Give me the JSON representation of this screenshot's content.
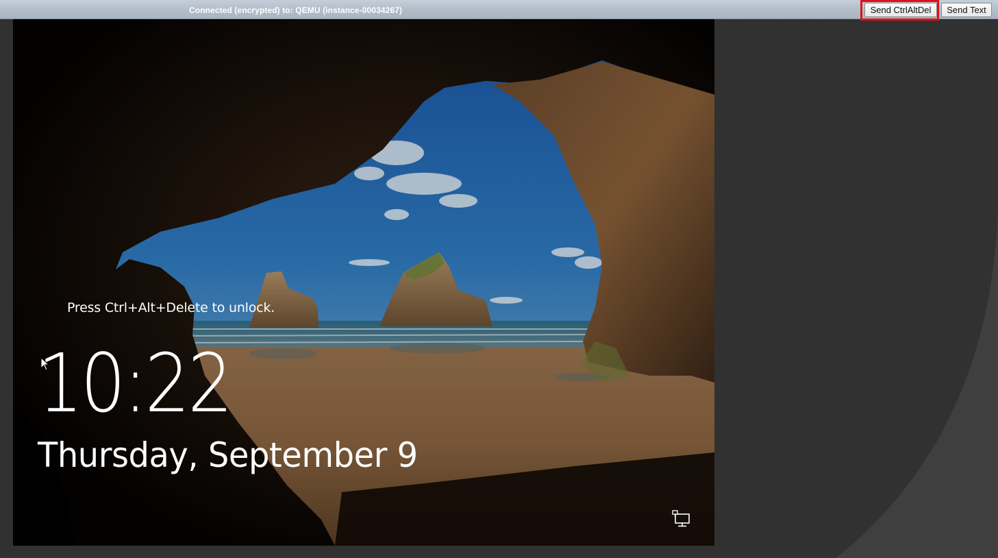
{
  "statusbar": {
    "connection_text": "Connected (encrypted) to: QEMU (instance-00034267)",
    "send_ctrlaltdel_label": "Send CtrlAltDel",
    "send_text_label": "Send Text"
  },
  "lockscreen": {
    "unlock_hint": "Press Ctrl+Alt+Delete to unlock.",
    "time": "10:22",
    "date": "Thursday, September 9",
    "network_icon": "network-monitor-icon"
  },
  "colors": {
    "background": "#313131",
    "statusbar": "#b2bdc9",
    "highlight": "#e0101c"
  }
}
